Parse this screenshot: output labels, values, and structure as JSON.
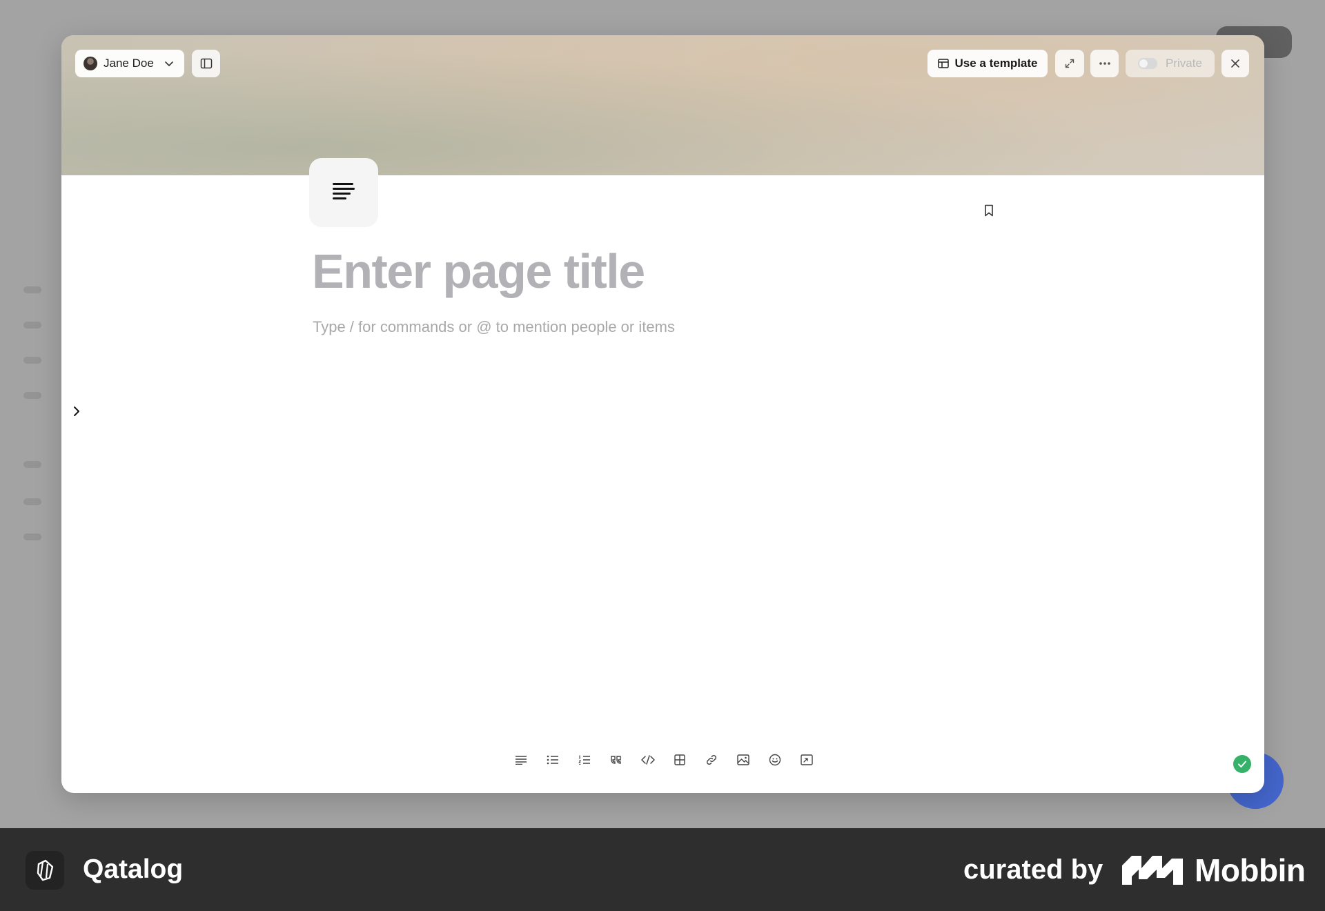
{
  "header": {
    "user_name": "Jane Doe",
    "template_label": "Use a template",
    "private_label": "Private"
  },
  "editor": {
    "title_placeholder": "Enter page title",
    "body_placeholder": "Type / for commands or @ to mention people or items"
  },
  "toolbar": {
    "tools": [
      "paragraph-icon",
      "bullet-list-icon",
      "numbered-list-icon",
      "quote-icon",
      "code-icon",
      "table-icon",
      "link-icon",
      "image-icon",
      "emoji-icon",
      "embed-icon"
    ]
  },
  "status": {
    "sync_color": "#36b16a"
  },
  "footer": {
    "app_name": "Qatalog",
    "curated_label": "curated by",
    "brand": "Mobbin"
  }
}
